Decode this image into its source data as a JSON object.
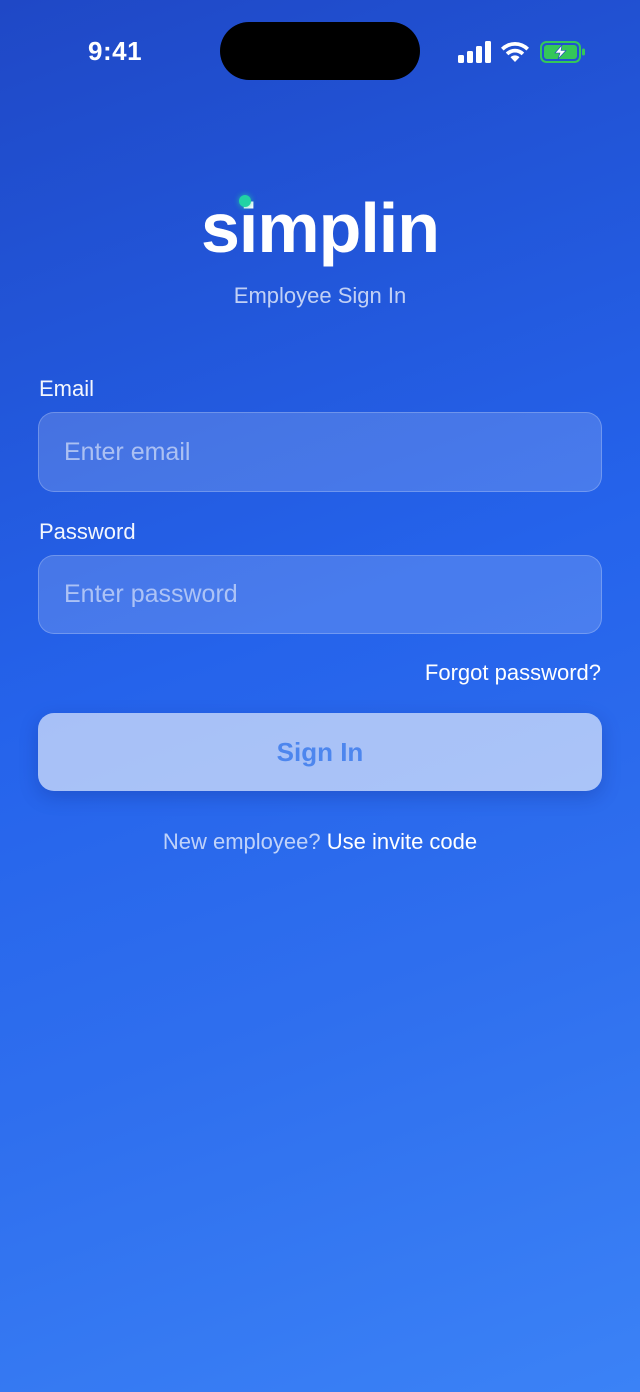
{
  "status_bar": {
    "time": "9:41",
    "icons": [
      "cellular-signal-icon",
      "wifi-icon",
      "battery-charging-icon"
    ],
    "battery_color": "#34c759"
  },
  "brand": {
    "logo_text": "simplin",
    "accent_dot_color": "#21d3a4",
    "subtitle": "Employee Sign In"
  },
  "form": {
    "email": {
      "label": "Email",
      "placeholder": "Enter email",
      "value": ""
    },
    "password": {
      "label": "Password",
      "placeholder": "Enter password",
      "value": ""
    },
    "forgot_label": "Forgot password?",
    "submit_label": "Sign In"
  },
  "footer": {
    "prompt": "New employee?",
    "link_label": "Use invite code"
  },
  "colors": {
    "background_top": "#1f48c6",
    "background_bottom": "#3b82f6",
    "button_text": "#4d86ee"
  }
}
